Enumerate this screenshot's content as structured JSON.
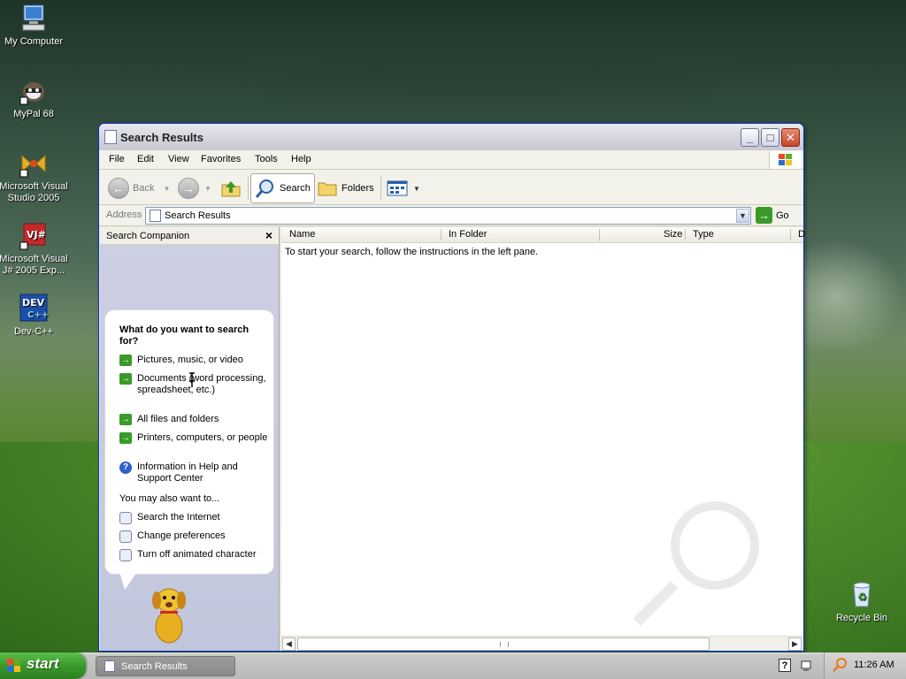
{
  "desktop": {
    "icons": [
      {
        "label": "My Computer"
      },
      {
        "label": "MyPal 68"
      },
      {
        "label": "Microsoft Visual Studio 2005"
      },
      {
        "label": "Microsoft Visual J# 2005 Exp..."
      },
      {
        "label": "Dev-C++"
      },
      {
        "label": "Recycle Bin"
      }
    ]
  },
  "window": {
    "title": "Search Results",
    "menu": [
      "File",
      "Edit",
      "View",
      "Favorites",
      "Tools",
      "Help"
    ],
    "toolbar": {
      "back": "Back",
      "search": "Search",
      "folders": "Folders"
    },
    "address": {
      "label": "Address",
      "value": "Search Results",
      "go": "Go"
    },
    "companion": {
      "title": "Search Companion",
      "question": "What do you want to search for?",
      "options": [
        "Pictures, music, or video",
        "Documents (word processing, spreadsheet, etc.)",
        "All files and folders",
        "Printers, computers, or people",
        "Information in Help and Support Center"
      ],
      "also_label": "You may also want to...",
      "also_options": [
        "Search the Internet",
        "Change preferences",
        "Turn off animated character"
      ]
    },
    "results": {
      "columns": [
        "Name",
        "In Folder",
        "Size",
        "Type",
        "D"
      ],
      "message": "To start your search, follow the instructions in the left pane."
    }
  },
  "taskbar": {
    "start": "start",
    "task": "Search Results",
    "clock": "11:26 AM"
  }
}
